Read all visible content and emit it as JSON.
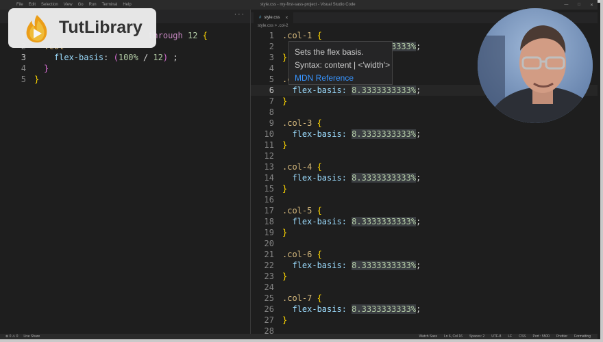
{
  "window": {
    "title": "style.css - my-first-sass-project - Visual Studio Code",
    "menu": [
      "File",
      "Edit",
      "Selection",
      "View",
      "Go",
      "Run",
      "Terminal",
      "Help"
    ]
  },
  "logo": {
    "brand": "TutLibrary"
  },
  "left_editor": {
    "lines": [
      {
        "n": "1",
        "partial": "through 12 {"
      },
      {
        "n": "2",
        "partial": ".col-#{$column-count} {"
      },
      {
        "n": "3",
        "partial": "flex-basis: (100% / 12) ;"
      },
      {
        "n": "4",
        "partial": "}"
      },
      {
        "n": "5",
        "partial": "}"
      }
    ]
  },
  "right_editor": {
    "tab": {
      "label": "style.css",
      "close": "×"
    },
    "breadcrumb": "style.css > .col-2",
    "rule_value": "8.3333333333%",
    "lines": [
      {
        "n": "1",
        "sel": ".col-1",
        "brace": "{"
      },
      {
        "n": "2",
        "prop": "flex-basis:",
        "val": "8.3333333333%",
        "end": ";"
      },
      {
        "n": "3",
        "brace": "}"
      },
      {
        "n": "4"
      },
      {
        "n": "5",
        "sel": ".c"
      },
      {
        "n": "6",
        "prop": "flex-basis:",
        "val": "8.3333333333%",
        "end": ";"
      },
      {
        "n": "7",
        "brace": "}"
      },
      {
        "n": "8"
      },
      {
        "n": "9",
        "sel": ".col-3",
        "brace": "{"
      },
      {
        "n": "10",
        "prop": "flex-basis:",
        "val": "8.3333333333%",
        "end": ";"
      },
      {
        "n": "11",
        "brace": "}"
      },
      {
        "n": "12"
      },
      {
        "n": "13",
        "sel": ".col-4",
        "brace": "{"
      },
      {
        "n": "14",
        "prop": "flex-basis:",
        "val": "8.3333333333%",
        "end": ";"
      },
      {
        "n": "15",
        "brace": "}"
      },
      {
        "n": "16"
      },
      {
        "n": "17",
        "sel": ".col-5",
        "brace": "{"
      },
      {
        "n": "18",
        "prop": "flex-basis:",
        "val": "8.3333333333%",
        "end": ";"
      },
      {
        "n": "19",
        "brace": "}"
      },
      {
        "n": "20"
      },
      {
        "n": "21",
        "sel": ".col-6",
        "brace": "{"
      },
      {
        "n": "22",
        "prop": "flex-basis:",
        "val": "8.3333333333%",
        "end": ";"
      },
      {
        "n": "23",
        "brace": "}"
      },
      {
        "n": "24"
      },
      {
        "n": "25",
        "sel": ".col-7",
        "brace": "{"
      },
      {
        "n": "26",
        "prop": "flex-basis:",
        "val": "8.3333333333%",
        "end": ";"
      },
      {
        "n": "27",
        "brace": "}"
      },
      {
        "n": "28"
      }
    ],
    "active_line": "6"
  },
  "hover": {
    "description": "Sets the flex basis.",
    "syntax": "Syntax: content | <'width'>",
    "link": "MDN Reference"
  },
  "statusbar": {
    "left": [
      "⊗ 0 ⚠ 0",
      "Live Share"
    ],
    "right": [
      "Watch Sass",
      "Ln 6, Col 16",
      "Spaces: 2",
      "UTF-8",
      "LF",
      "CSS",
      "Port : 5500",
      "Prettier",
      "Formatting"
    ]
  }
}
